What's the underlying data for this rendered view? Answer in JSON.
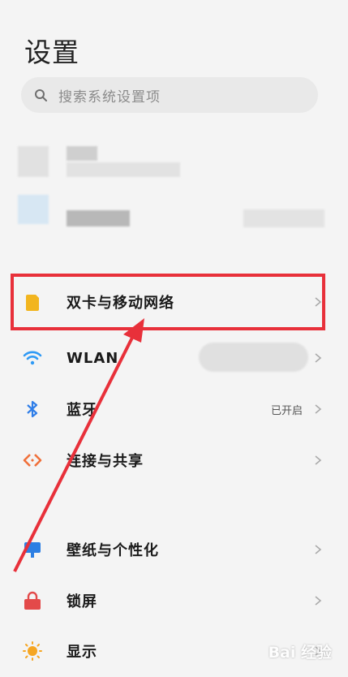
{
  "page": {
    "title": "设置"
  },
  "search": {
    "placeholder": "搜索系统设置项",
    "icon": "search-icon"
  },
  "menu": [
    {
      "id": "dual-sim",
      "label": "双卡与移动网络",
      "icon": "sim-card-icon",
      "value": ""
    },
    {
      "id": "wlan",
      "label": "WLAN",
      "icon": "wifi-icon",
      "value": ""
    },
    {
      "id": "bluetooth",
      "label": "蓝牙",
      "icon": "bluetooth-icon",
      "value": "已开启"
    },
    {
      "id": "connection-sharing",
      "label": "连接与共享",
      "icon": "connection-share-icon",
      "value": ""
    },
    {
      "id": "wallpaper",
      "label": "壁纸与个性化",
      "icon": "wallpaper-icon",
      "value": ""
    },
    {
      "id": "lockscreen",
      "label": "锁屏",
      "icon": "lock-icon",
      "value": ""
    },
    {
      "id": "display",
      "label": "显示",
      "icon": "brightness-icon",
      "value": ""
    }
  ],
  "colors": {
    "accent": "#e8303a",
    "sim": "#f2b51f",
    "wifi": "#2f9af5",
    "bluetooth": "#2f7ee8",
    "share": "#f0703a",
    "wallpaper": "#2d7fe3",
    "lock": "#e34a4a",
    "display": "#f5a623"
  },
  "watermark": "Bai 经验"
}
